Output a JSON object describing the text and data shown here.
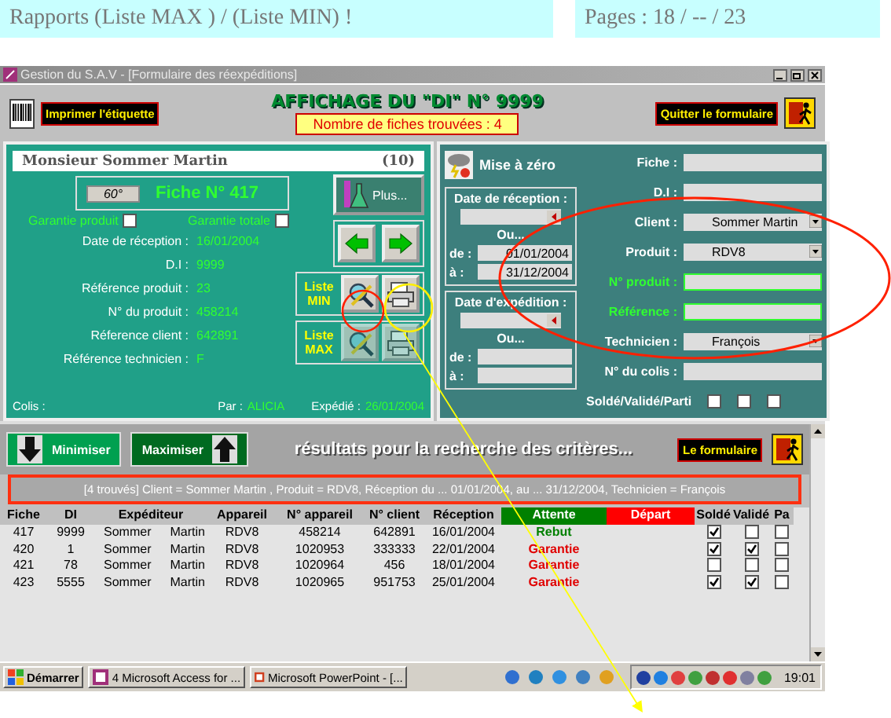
{
  "header": {
    "left": "Rapports  (Liste MAX ) /  (Liste MIN) !",
    "right": "Pages : 18 / -- / 23"
  },
  "window": {
    "title": "Gestion du S.A.V - [Formulaire des réexpéditions]"
  },
  "toolbar": {
    "print_button": "Imprimer  l'étiquette",
    "heading": "AFFICHAGE DU \"DI\" N° 9999",
    "count": "Nombre de fiches trouvées : 4",
    "quit_button": "Quitter le formulaire"
  },
  "record": {
    "name": "Monsieur  Sommer  Martin",
    "number": "(10)",
    "angle_button": "60°",
    "fiche": "Fiche N° 417",
    "checks": [
      {
        "label": "Garantie produit",
        "checked": false
      },
      {
        "label": "Garantie totale",
        "checked": false
      }
    ],
    "fields": [
      {
        "label": "Date de réception :",
        "value": "16/01/2004"
      },
      {
        "label": "D.I :",
        "value": "9999"
      },
      {
        "label": "Référence produit :",
        "value": "23"
      },
      {
        "label": "N° du produit :",
        "value": "458214"
      },
      {
        "label": "Réference client :",
        "value": "642891"
      },
      {
        "label": "Référence technicien :",
        "value": "F"
      }
    ],
    "plus_button": "Plus...",
    "list_min": "Liste MIN",
    "list_max": "Liste MAX",
    "colis_label": "Colis :",
    "par_label": "Par :",
    "par_value": "ALICIA",
    "shipped_label": "Expédié :",
    "shipped_value": "26/01/2004"
  },
  "search": {
    "reset_button": "Mise à zéro",
    "reception": {
      "title": "Date de réception :",
      "or": "Ou...",
      "from_label": "de :",
      "from": "01/01/2004",
      "to_label": "à :",
      "to": "31/12/2004"
    },
    "shipping": {
      "title": "Date d'expédition :",
      "or": "Ou...",
      "from_label": "de :",
      "to_label": "à :"
    },
    "fields": [
      {
        "label": "Fiche :",
        "kind": "text"
      },
      {
        "label": "D.I :",
        "kind": "text"
      },
      {
        "label": "Client :",
        "kind": "combo",
        "value": "Sommer  Martin"
      },
      {
        "label": "Produit :",
        "kind": "combo",
        "value": "RDV8"
      },
      {
        "label": "N° produit :",
        "kind": "highlight"
      },
      {
        "label": "Référence :",
        "kind": "highlight"
      },
      {
        "label": "Technicien :",
        "kind": "combo",
        "value": "François"
      },
      {
        "label": "N° du colis :",
        "kind": "text"
      }
    ],
    "flags_label": "Soldé/Validé/Parti",
    "flags": [
      {
        "checked": false
      },
      {
        "checked": false
      },
      {
        "checked": false
      }
    ]
  },
  "results": {
    "minimize_button": "Minimiser",
    "maximize_button": "Maximiser",
    "title": "résultats pour la recherche des critères...",
    "form_button": "Le formulaire",
    "filter": "[4 trouvés]  Client = Sommer  Martin , Produit = RDV8, Réception du ... 01/01/2004, au ... 31/12/2004, Technicien = François",
    "columns": [
      {
        "label": "Fiche",
        "kind": "plain"
      },
      {
        "label": "DI",
        "kind": "plain"
      },
      {
        "label": "Expéditeur",
        "kind": "plain"
      },
      {
        "label": "Appareil",
        "kind": "plain"
      },
      {
        "label": "N° appareil",
        "kind": "plain"
      },
      {
        "label": "N° client",
        "kind": "plain"
      },
      {
        "label": "Réception",
        "kind": "plain"
      },
      {
        "label": "Attente",
        "kind": "colored",
        "color": "#008000"
      },
      {
        "label": "Départ",
        "kind": "colored",
        "color": "#ff0000"
      },
      {
        "label": "Soldé",
        "kind": "plain"
      },
      {
        "label": "Validé",
        "kind": "plain"
      },
      {
        "label": "Pa",
        "kind": "plain"
      }
    ],
    "rows": [
      {
        "fiche": "417",
        "di": "9999",
        "last": "Sommer",
        "first": "Martin",
        "device": "RDV8",
        "device_no": "458214",
        "client_no": "642891",
        "received": "16/01/2004",
        "status": "Rebut",
        "kind": "rebut",
        "solde": true,
        "valide": false,
        "parti": false
      },
      {
        "fiche": "420",
        "di": "1",
        "last": "Sommer",
        "first": "Martin",
        "device": "RDV8",
        "device_no": "1020953",
        "client_no": "333333",
        "received": "22/01/2004",
        "status": "Garantie",
        "kind": "garantie",
        "solde": true,
        "valide": true,
        "parti": false
      },
      {
        "fiche": "421",
        "di": "78",
        "last": "Sommer",
        "first": "Martin",
        "device": "RDV8",
        "device_no": "1020964",
        "client_no": "456",
        "received": "18/01/2004",
        "status": "Garantie",
        "kind": "garantie",
        "solde": false,
        "valide": false,
        "parti": false
      },
      {
        "fiche": "423",
        "di": "5555",
        "last": "Sommer",
        "first": "Martin",
        "device": "RDV8",
        "device_no": "1020965",
        "client_no": "951753",
        "received": "25/01/2004",
        "status": "Garantie",
        "kind": "garantie",
        "solde": true,
        "valide": true,
        "parti": false
      }
    ]
  },
  "taskbar": {
    "start": "Démarrer",
    "tasks": [
      "4 Microsoft Access for ...",
      "Microsoft PowerPoint - [..."
    ],
    "clock": "19:01"
  }
}
